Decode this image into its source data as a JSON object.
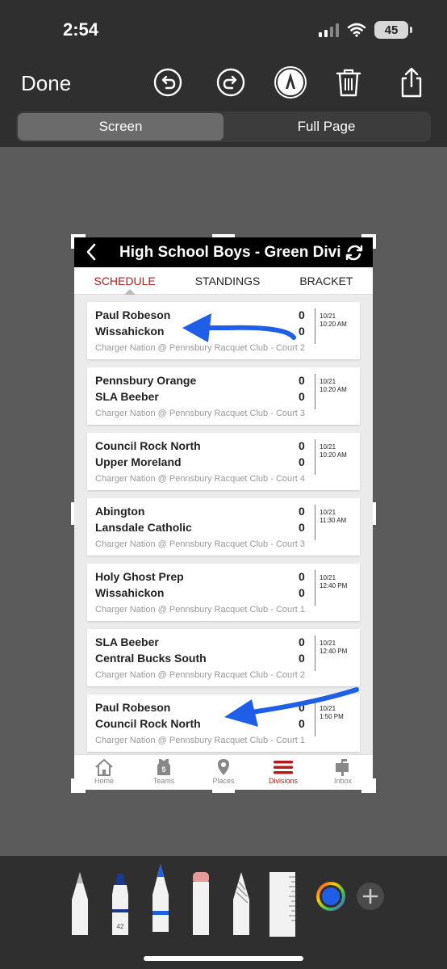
{
  "status_bar": {
    "time": "2:54",
    "battery": "45"
  },
  "toolbar": {
    "done_label": "Done"
  },
  "segmented": {
    "screen": "Screen",
    "full_page": "Full Page"
  },
  "app": {
    "title": "High School Boys - Green Divi",
    "tabs": [
      "SCHEDULE",
      "STANDINGS",
      "BRACKET"
    ],
    "games": [
      {
        "team1": "Paul Robeson",
        "team2": "Wissahickon",
        "score1": "0",
        "score2": "0",
        "date": "10/21",
        "time": "10:20 AM",
        "venue": "Charger Nation @ Pennsbury Racquet Club - Court 2"
      },
      {
        "team1": "Pennsbury Orange",
        "team2": "SLA Beeber",
        "score1": "0",
        "score2": "0",
        "date": "10/21",
        "time": "10:20 AM",
        "venue": "Charger Nation @ Pennsbury Racquet Club - Court 3"
      },
      {
        "team1": "Council Rock North",
        "team2": "Upper Moreland",
        "score1": "0",
        "score2": "0",
        "date": "10/21",
        "time": "10:20 AM",
        "venue": "Charger Nation @ Pennsbury Racquet Club - Court 4"
      },
      {
        "team1": "Abington",
        "team2": "Lansdale Catholic",
        "score1": "0",
        "score2": "0",
        "date": "10/21",
        "time": "11:30 AM",
        "venue": "Charger Nation @ Pennsbury Racquet Club - Court 3"
      },
      {
        "team1": "Holy Ghost Prep",
        "team2": "Wissahickon",
        "score1": "0",
        "score2": "0",
        "date": "10/21",
        "time": "12:40 PM",
        "venue": "Charger Nation @ Pennsbury Racquet Club - Court 1"
      },
      {
        "team1": "SLA Beeber",
        "team2": "Central Bucks South",
        "score1": "0",
        "score2": "0",
        "date": "10/21",
        "time": "12:40 PM",
        "venue": "Charger Nation @ Pennsbury Racquet Club - Court 2"
      },
      {
        "team1": "Paul Robeson",
        "team2": "Council Rock North",
        "score1": "0",
        "score2": "0",
        "date": "10/21",
        "time": "1:50 PM",
        "venue": "Charger Nation @ Pennsbury Racquet Club - Court 1"
      }
    ],
    "bottom_nav": [
      {
        "label": "Home",
        "icon": "home-icon"
      },
      {
        "label": "Teams",
        "icon": "jersey-icon",
        "badge": "5"
      },
      {
        "label": "Places",
        "icon": "map-pin-icon"
      },
      {
        "label": "Divisions",
        "icon": "menu-icon"
      },
      {
        "label": "Inbox",
        "icon": "mailbox-icon"
      }
    ]
  },
  "markup_tools": {
    "marker_number": "42"
  },
  "colors": {
    "accent_red": "#b01c1c",
    "arrow_blue": "#1f5fe8"
  }
}
